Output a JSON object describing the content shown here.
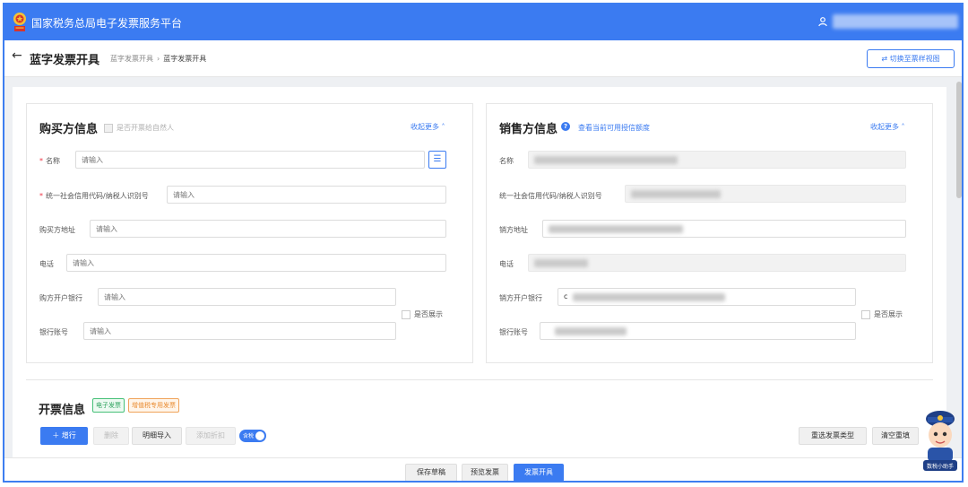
{
  "app": {
    "title": "国家税务总局电子发票服务平台",
    "user_name": ""
  },
  "header": {
    "title": "蓝字发票开具",
    "breadcrumb": [
      "蓝字发票开具",
      "蓝字发票开具"
    ],
    "switch_label": "切换至票样视图"
  },
  "buyer": {
    "title": "购买方信息",
    "natural_person_label": "是否开票给自然人",
    "collapse_label": "收起更多",
    "fields": {
      "name": {
        "label": "名称",
        "placeholder": "请输入"
      },
      "tax_id": {
        "label": "统一社会信用代码/纳税人识别号",
        "placeholder": "请输入"
      },
      "address": {
        "label": "购买方地址",
        "placeholder": "请输入"
      },
      "phone": {
        "label": "电话",
        "placeholder": "请输入"
      },
      "bank": {
        "label": "购方开户银行",
        "placeholder": "请输入"
      },
      "account": {
        "label": "银行账号",
        "placeholder": "请输入"
      }
    },
    "show_label": "是否展示"
  },
  "seller": {
    "title": "销售方信息",
    "quota_link": "查看当前可用授信额度",
    "collapse_label": "收起更多",
    "fields": {
      "name": {
        "label": "名称"
      },
      "tax_id": {
        "label": "统一社会信用代码/纳税人识别号"
      },
      "address": {
        "label": "销方地址"
      },
      "phone": {
        "label": "电话"
      },
      "bank": {
        "label": "销方开户银行",
        "value_prefix": "c"
      },
      "account": {
        "label": "银行账号"
      }
    },
    "show_label": "是否展示"
  },
  "invoice": {
    "title": "开票信息",
    "tags": [
      "电子发票",
      "增值税专用发票"
    ],
    "buttons": {
      "add_row": "增行",
      "delete": "删除",
      "import": "明细导入",
      "discount": "添加折扣"
    },
    "tax_toggle": "含税",
    "reselect": "重选发票类型",
    "clear": "清空重填"
  },
  "footer": {
    "save_draft": "保存草稿",
    "preview": "预览发票",
    "issue": "发票开具"
  },
  "assistant": {
    "caption": "数税小助手"
  },
  "colors": {
    "primary": "#3b7bf1",
    "green_tag": "#2ea35f",
    "orange_tag": "#e98a2f"
  }
}
